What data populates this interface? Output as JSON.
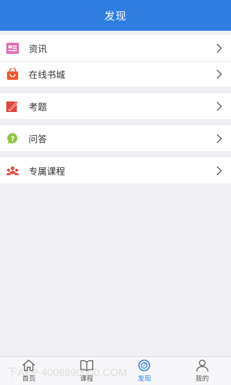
{
  "header": {
    "title": "发现"
  },
  "menu": {
    "items": [
      {
        "label": "资讯"
      },
      {
        "label": "在线书城"
      },
      {
        "label": "考题"
      },
      {
        "label": "问答"
      },
      {
        "label": "专属课程"
      }
    ]
  },
  "tabbar": {
    "tabs": [
      {
        "label": "首页"
      },
      {
        "label": "课程"
      },
      {
        "label": "发现"
      },
      {
        "label": "我的"
      }
    ]
  },
  "watermark": "下APP  4008890000.COM",
  "colors": {
    "accent": "#2f7de1"
  }
}
